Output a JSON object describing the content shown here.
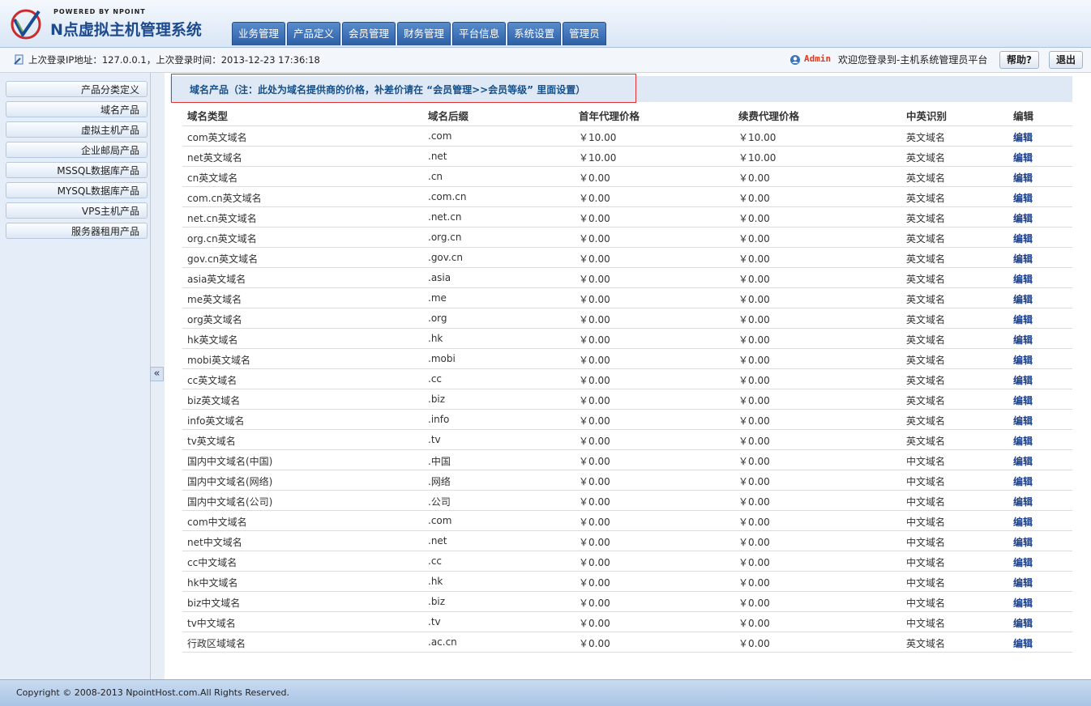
{
  "header": {
    "powered_by": "POWERED BY NPOINT",
    "app_title": "N点虚拟主机管理系统",
    "nav": [
      "业务管理",
      "产品定义",
      "会员管理",
      "财务管理",
      "平台信息",
      "系统设置",
      "管理员"
    ]
  },
  "infobar": {
    "last_login": "上次登录IP地址：127.0.0.1，上次登录时间：2013-12-23 17:36:18",
    "admin_name": "Admin",
    "welcome": "欢迎您登录到-主机系统管理员平台",
    "help_label": "帮助?",
    "logout_label": "退出"
  },
  "sidebar": {
    "items": [
      "产品分类定义",
      "域名产品",
      "虚拟主机产品",
      "企业邮局产品",
      "MSSQL数据库产品",
      "MYSQL数据库产品",
      "VPS主机产品",
      "服务器租用产品"
    ],
    "collapse_label": "«"
  },
  "main": {
    "note": "域名产品（注：此处为域名提供商的价格，补差价请在 “会员管理>>会员等级” 里面设置）",
    "columns": [
      "域名类型",
      "域名后缀",
      "首年代理价格",
      "续费代理价格",
      "中英识别",
      "编辑"
    ],
    "rows": [
      [
        "com英文域名",
        ".com",
        "￥10.00",
        "￥10.00",
        "英文域名",
        "编辑"
      ],
      [
        "net英文域名",
        ".net",
        "￥10.00",
        "￥10.00",
        "英文域名",
        "编辑"
      ],
      [
        "cn英文域名",
        ".cn",
        "￥0.00",
        "￥0.00",
        "英文域名",
        "编辑"
      ],
      [
        "com.cn英文域名",
        ".com.cn",
        "￥0.00",
        "￥0.00",
        "英文域名",
        "编辑"
      ],
      [
        "net.cn英文域名",
        ".net.cn",
        "￥0.00",
        "￥0.00",
        "英文域名",
        "编辑"
      ],
      [
        "org.cn英文域名",
        ".org.cn",
        "￥0.00",
        "￥0.00",
        "英文域名",
        "编辑"
      ],
      [
        "gov.cn英文域名",
        ".gov.cn",
        "￥0.00",
        "￥0.00",
        "英文域名",
        "编辑"
      ],
      [
        "asia英文域名",
        ".asia",
        "￥0.00",
        "￥0.00",
        "英文域名",
        "编辑"
      ],
      [
        "me英文域名",
        ".me",
        "￥0.00",
        "￥0.00",
        "英文域名",
        "编辑"
      ],
      [
        "org英文域名",
        ".org",
        "￥0.00",
        "￥0.00",
        "英文域名",
        "编辑"
      ],
      [
        "hk英文域名",
        ".hk",
        "￥0.00",
        "￥0.00",
        "英文域名",
        "编辑"
      ],
      [
        "mobi英文域名",
        ".mobi",
        "￥0.00",
        "￥0.00",
        "英文域名",
        "编辑"
      ],
      [
        "cc英文域名",
        ".cc",
        "￥0.00",
        "￥0.00",
        "英文域名",
        "编辑"
      ],
      [
        "biz英文域名",
        ".biz",
        "￥0.00",
        "￥0.00",
        "英文域名",
        "编辑"
      ],
      [
        "info英文域名",
        ".info",
        "￥0.00",
        "￥0.00",
        "英文域名",
        "编辑"
      ],
      [
        "tv英文域名",
        ".tv",
        "￥0.00",
        "￥0.00",
        "英文域名",
        "编辑"
      ],
      [
        "国内中文域名(中国)",
        ".中国",
        "￥0.00",
        "￥0.00",
        "中文域名",
        "编辑"
      ],
      [
        "国内中文域名(网络)",
        ".网络",
        "￥0.00",
        "￥0.00",
        "中文域名",
        "编辑"
      ],
      [
        "国内中文域名(公司)",
        ".公司",
        "￥0.00",
        "￥0.00",
        "中文域名",
        "编辑"
      ],
      [
        "com中文域名",
        ".com",
        "￥0.00",
        "￥0.00",
        "中文域名",
        "编辑"
      ],
      [
        "net中文域名",
        ".net",
        "￥0.00",
        "￥0.00",
        "中文域名",
        "编辑"
      ],
      [
        "cc中文域名",
        ".cc",
        "￥0.00",
        "￥0.00",
        "中文域名",
        "编辑"
      ],
      [
        "hk中文域名",
        ".hk",
        "￥0.00",
        "￥0.00",
        "中文域名",
        "编辑"
      ],
      [
        "biz中文域名",
        ".biz",
        "￥0.00",
        "￥0.00",
        "中文域名",
        "编辑"
      ],
      [
        "tv中文域名",
        ".tv",
        "￥0.00",
        "￥0.00",
        "中文域名",
        "编辑"
      ],
      [
        "行政区域域名",
        ".ac.cn",
        "￥0.00",
        "￥0.00",
        "英文域名",
        "编辑"
      ]
    ]
  },
  "footer": {
    "copyright": "Copyright © 2008-2013 NpointHost.com.All Rights Reserved."
  },
  "icons": {
    "logo": "logo-checkmark-icon",
    "login": "login-info-icon",
    "user": "user-icon"
  },
  "colors": {
    "nav": "#2b5fa6",
    "note_border": "#e03232",
    "note_text": "#15508a",
    "admin": "#e03a1e"
  }
}
